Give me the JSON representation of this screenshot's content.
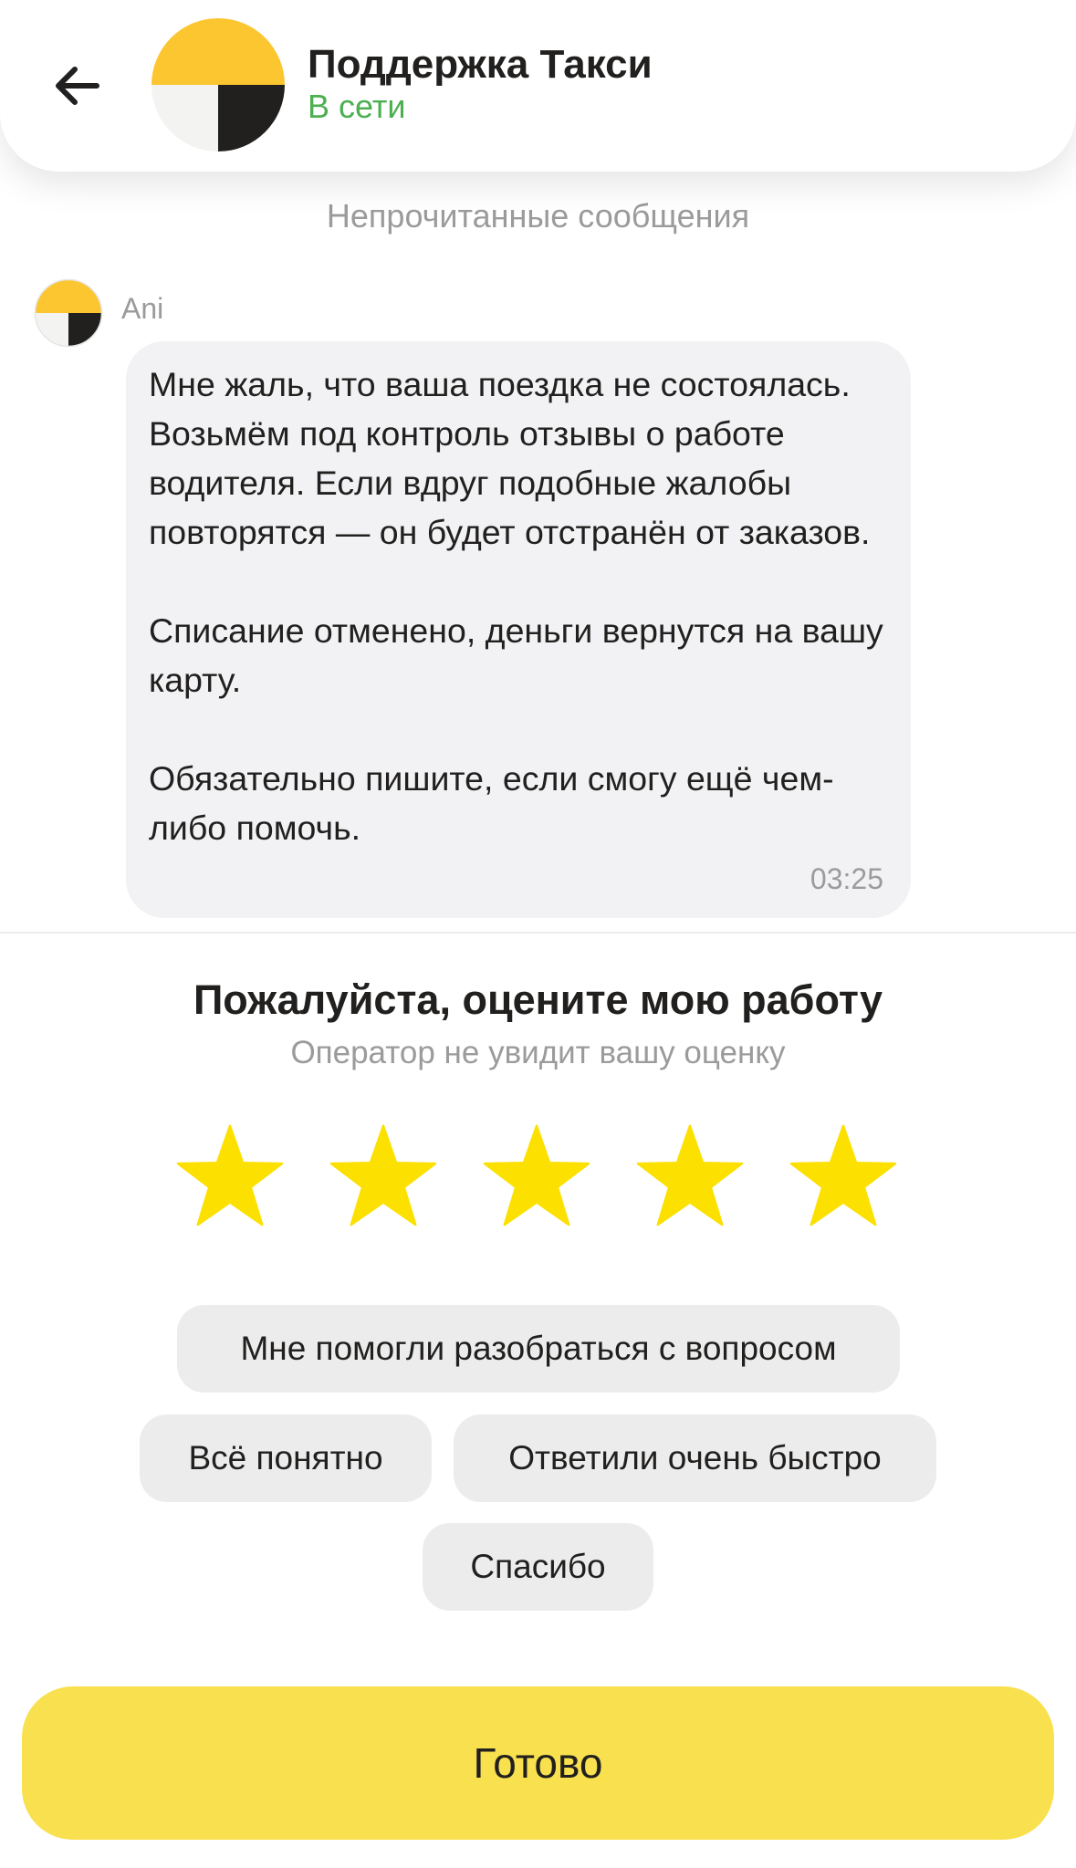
{
  "header": {
    "title": "Поддержка Такси",
    "status": "В сети",
    "status_color": "#4caf50"
  },
  "chat": {
    "unread_label": "Непрочитанные сообщения",
    "message": {
      "sender": "Ani",
      "text": "Мне жаль, что ваша поездка не состоялась. Возьмём под контроль отзывы о работе водителя. Если вдруг подобные жалобы повторятся — он будет отстранён от заказов.\n\nСписание отменено, деньги вернутся на вашу карту.\n\nОбязательно пишите, если смогу ещё чем-либо помочь.",
      "time": "03:25"
    }
  },
  "rating": {
    "title": "Пожалуйста, оцените мою работу",
    "subtitle": "Оператор не увидит вашу оценку",
    "stars_selected": 5,
    "stars_total": 5,
    "star_color": "#fce000",
    "chips": [
      "Мне помогли разобраться с вопросом",
      "Всё понятно",
      "Ответили очень быстро",
      "Спасибо"
    ]
  },
  "done_button": {
    "label": "Готово",
    "color": "#f8e04e"
  },
  "icons": {
    "back": "arrow-left-icon",
    "logo": "yandex-taxi-logo-icon",
    "star": "star-icon"
  }
}
